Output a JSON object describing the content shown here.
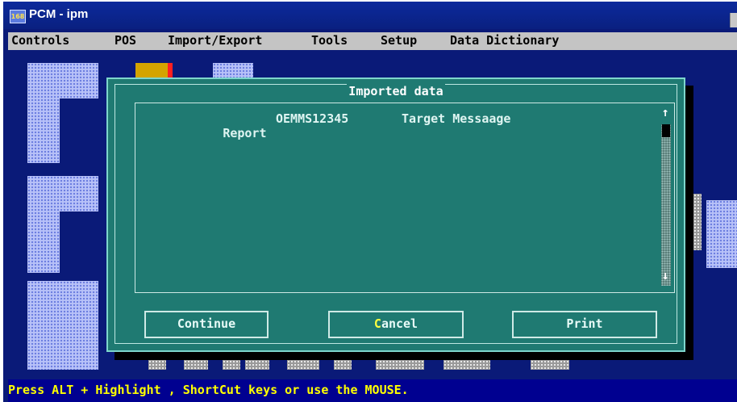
{
  "window": {
    "title": "PCM - ipm",
    "app_icon_text": "168"
  },
  "menu": [
    "Controls",
    "POS",
    "Import/Export",
    "Tools",
    "Setup",
    "Data Dictionary"
  ],
  "dialog": {
    "title": "Imported data",
    "rows": [
      {
        "type": "Report",
        "code": "OEMMS12345",
        "message": "Target Messaage"
      }
    ],
    "scroll_up": "↑",
    "scroll_down": "↓",
    "buttons": {
      "continue": "Continue",
      "cancel_hot": "C",
      "cancel_rest": "ancel",
      "print": "Print"
    }
  },
  "status": {
    "text": "Press ALT + Highlight , ShortCut keys or use the MOUSE."
  },
  "colors": {
    "desktop": "#0a1a78",
    "dialog": "#1f7a72",
    "status_text": "#ffff00",
    "menu_bg": "#c4c4c4"
  }
}
